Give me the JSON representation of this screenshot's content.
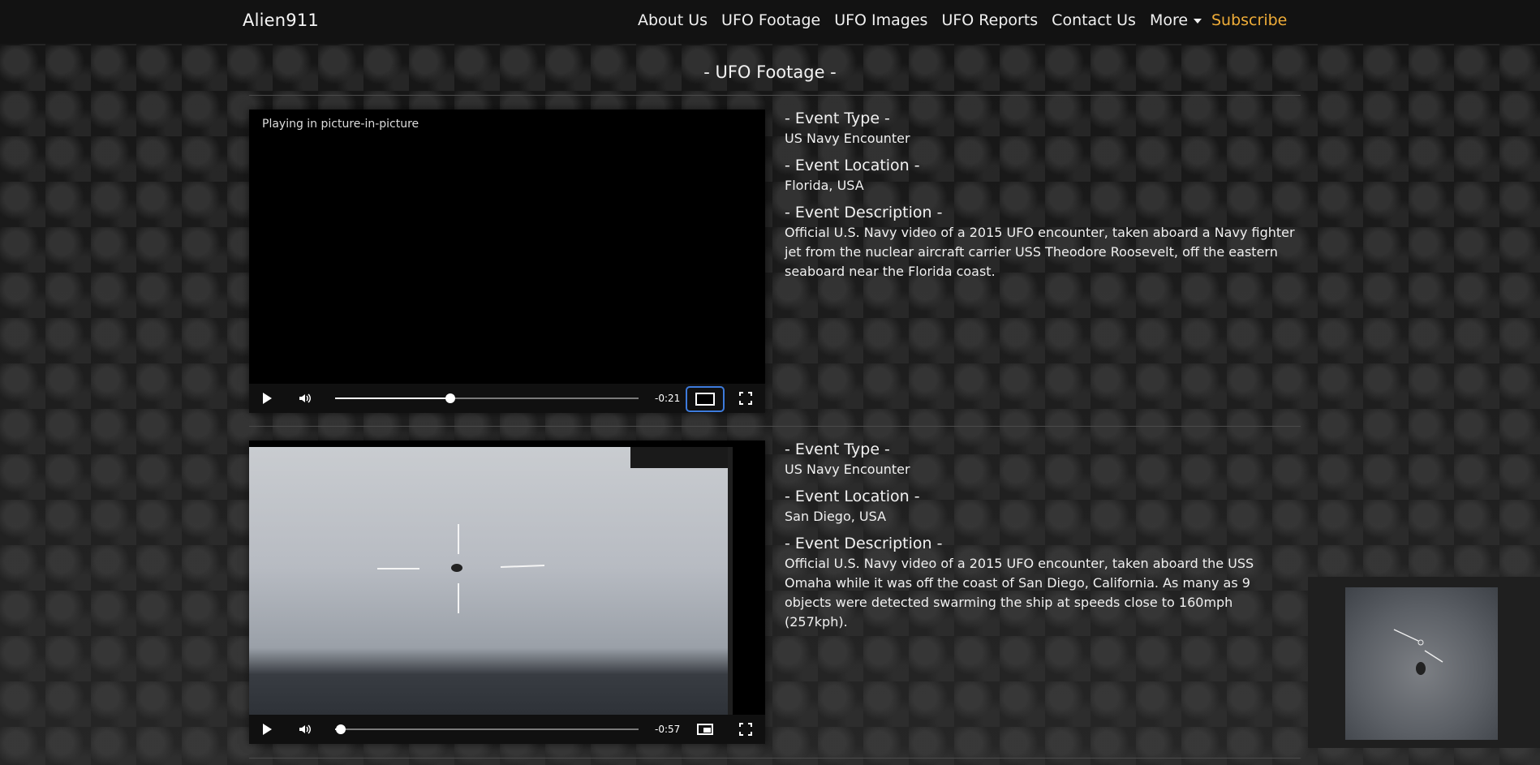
{
  "nav": {
    "brand": "Alien911",
    "links": [
      "About Us",
      "UFO Footage",
      "UFO Images",
      "UFO Reports",
      "Contact Us"
    ],
    "more": "More",
    "subscribe": "Subscribe"
  },
  "page_title": "- UFO Footage -",
  "videos": [
    {
      "overlay_text": "Playing in picture-in-picture",
      "time_remaining": "-0:21",
      "progress": 0.38,
      "event_type_heading": "- Event Type -",
      "event_type": "US Navy Encounter",
      "event_location_heading": "- Event Location -",
      "event_location": "Florida, USA",
      "event_description_heading": "- Event Description -",
      "event_description": "Official U.S. Navy video of a 2015 UFO encounter, taken aboard a Navy fighter jet from the nuclear aircraft carrier USS Theodore Roosevelt, off the eastern seaboard near the Florida coast."
    },
    {
      "time_remaining": "-0:57",
      "progress": 0.02,
      "event_type_heading": "- Event Type -",
      "event_type": "US Navy Encounter",
      "event_location_heading": "- Event Location -",
      "event_location": "San Diego, USA",
      "event_description_heading": "- Event Description -",
      "event_description": "Official U.S. Navy video of a 2015 UFO encounter, taken aboard the USS Omaha while it was off the coast of San Diego, California. As many as 9 objects were detected swarming the ship at speeds close to 160mph (257kph)."
    }
  ],
  "colors": {
    "subscribe": "#f0ad38",
    "focus_ring": "#3d7bdc"
  }
}
